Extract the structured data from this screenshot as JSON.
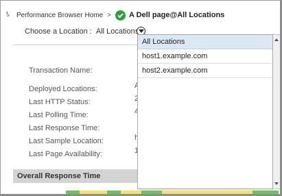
{
  "breadcrumb": {
    "home_label": "Performance Browser Home",
    "separator": ">",
    "current": "A Dell page@All Locations"
  },
  "location_selector": {
    "label": "Choose a Location :",
    "value": "All Locations"
  },
  "details": {
    "labels": [
      "Transaction Name:",
      "Deployed Locations:",
      "Last HTTP Status:",
      "Last Polling Time:",
      "Last Response Time:",
      "Last Sample Location:",
      "Last Page Availability:"
    ],
    "peek_values": [
      "A",
      "2",
      "4",
      "",
      "h",
      "1"
    ]
  },
  "section": {
    "title": "Overall Response Time"
  },
  "dropdown": {
    "options": [
      "All Locations",
      "host1.example.com",
      "host2.example.com"
    ],
    "selected": "All Locations"
  },
  "colors": {
    "success_green": "#2e9e3c",
    "selected_bg": "#dde8f5",
    "section_bg": "#d4d4d4",
    "bar_green": "#6cc35a",
    "bar_yellow": "#f1e26a"
  }
}
